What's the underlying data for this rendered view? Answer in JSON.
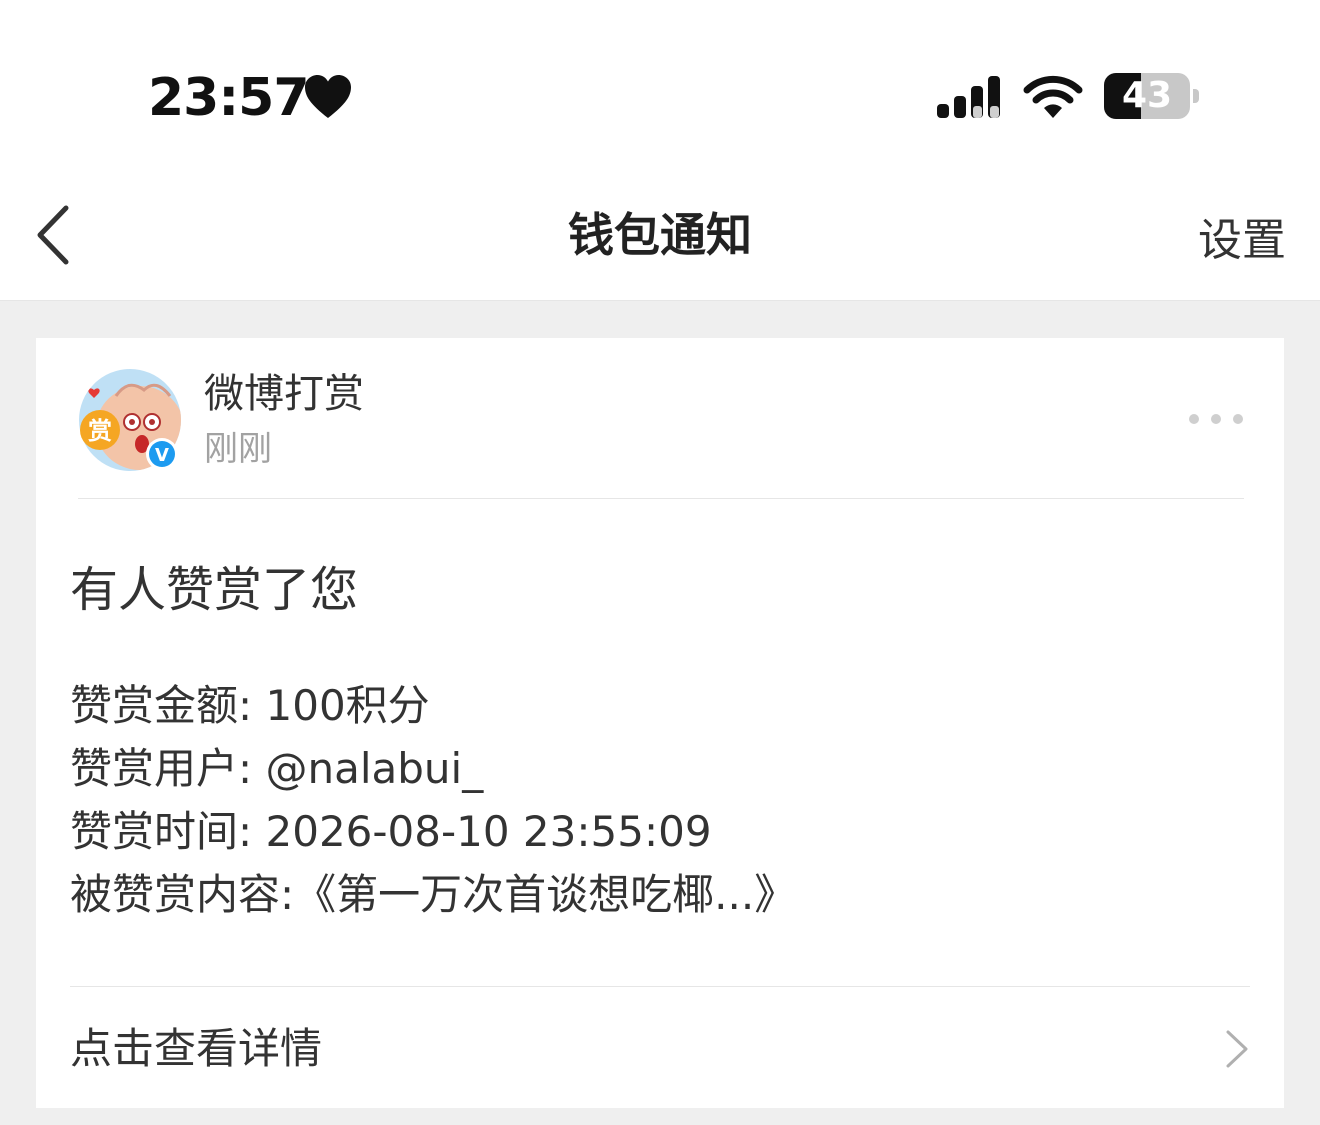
{
  "status_bar": {
    "time": "23:57",
    "battery_level": "43",
    "battery_fraction": 0.43
  },
  "nav": {
    "title": "钱包通知",
    "settings_label": "设置"
  },
  "message": {
    "sender_name": "微博打赏",
    "sender_time": "刚刚",
    "avatar_badge": "赏",
    "verified_mark": "V",
    "title": "有人赞赏了您",
    "details": [
      "赞赏金额: 100积分",
      "赞赏用户: @nalabui_",
      "赞赏时间: 2026-08-10 23:55:09",
      "被赞赏内容:《第一万次首谈想吃椰...》"
    ],
    "view_details_label": "点击查看详情"
  },
  "colors": {
    "page_bg": "#efefef",
    "card_bg": "#ffffff",
    "text_primary": "#333333",
    "text_secondary": "#a2a2a2",
    "verified_blue": "#1d9bf0",
    "avatar_badge": "#f5a623"
  },
  "icons": [
    "heart-icon",
    "signal-icon",
    "wifi-icon",
    "battery-icon",
    "back-arrow-icon",
    "more-dots-icon",
    "chevron-right-icon",
    "verified-icon"
  ]
}
